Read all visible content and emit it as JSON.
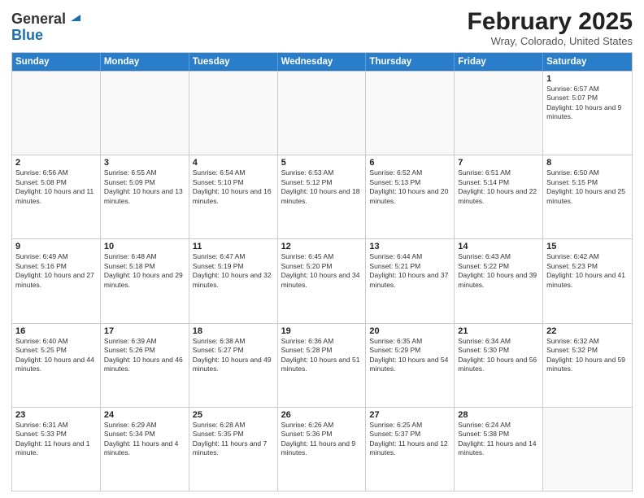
{
  "header": {
    "logo_line1": "General",
    "logo_line2": "Blue",
    "title": "February 2025",
    "subtitle": "Wray, Colorado, United States"
  },
  "calendar": {
    "days_of_week": [
      "Sunday",
      "Monday",
      "Tuesday",
      "Wednesday",
      "Thursday",
      "Friday",
      "Saturday"
    ],
    "weeks": [
      [
        {
          "day": "",
          "empty": true
        },
        {
          "day": "",
          "empty": true
        },
        {
          "day": "",
          "empty": true
        },
        {
          "day": "",
          "empty": true
        },
        {
          "day": "",
          "empty": true
        },
        {
          "day": "",
          "empty": true
        },
        {
          "day": "1",
          "sunrise": "6:57 AM",
          "sunset": "5:07 PM",
          "daylight": "10 hours and 9 minutes."
        }
      ],
      [
        {
          "day": "2",
          "sunrise": "6:56 AM",
          "sunset": "5:08 PM",
          "daylight": "10 hours and 11 minutes."
        },
        {
          "day": "3",
          "sunrise": "6:55 AM",
          "sunset": "5:09 PM",
          "daylight": "10 hours and 13 minutes."
        },
        {
          "day": "4",
          "sunrise": "6:54 AM",
          "sunset": "5:10 PM",
          "daylight": "10 hours and 16 minutes."
        },
        {
          "day": "5",
          "sunrise": "6:53 AM",
          "sunset": "5:12 PM",
          "daylight": "10 hours and 18 minutes."
        },
        {
          "day": "6",
          "sunrise": "6:52 AM",
          "sunset": "5:13 PM",
          "daylight": "10 hours and 20 minutes."
        },
        {
          "day": "7",
          "sunrise": "6:51 AM",
          "sunset": "5:14 PM",
          "daylight": "10 hours and 22 minutes."
        },
        {
          "day": "8",
          "sunrise": "6:50 AM",
          "sunset": "5:15 PM",
          "daylight": "10 hours and 25 minutes."
        }
      ],
      [
        {
          "day": "9",
          "sunrise": "6:49 AM",
          "sunset": "5:16 PM",
          "daylight": "10 hours and 27 minutes."
        },
        {
          "day": "10",
          "sunrise": "6:48 AM",
          "sunset": "5:18 PM",
          "daylight": "10 hours and 29 minutes."
        },
        {
          "day": "11",
          "sunrise": "6:47 AM",
          "sunset": "5:19 PM",
          "daylight": "10 hours and 32 minutes."
        },
        {
          "day": "12",
          "sunrise": "6:45 AM",
          "sunset": "5:20 PM",
          "daylight": "10 hours and 34 minutes."
        },
        {
          "day": "13",
          "sunrise": "6:44 AM",
          "sunset": "5:21 PM",
          "daylight": "10 hours and 37 minutes."
        },
        {
          "day": "14",
          "sunrise": "6:43 AM",
          "sunset": "5:22 PM",
          "daylight": "10 hours and 39 minutes."
        },
        {
          "day": "15",
          "sunrise": "6:42 AM",
          "sunset": "5:23 PM",
          "daylight": "10 hours and 41 minutes."
        }
      ],
      [
        {
          "day": "16",
          "sunrise": "6:40 AM",
          "sunset": "5:25 PM",
          "daylight": "10 hours and 44 minutes."
        },
        {
          "day": "17",
          "sunrise": "6:39 AM",
          "sunset": "5:26 PM",
          "daylight": "10 hours and 46 minutes."
        },
        {
          "day": "18",
          "sunrise": "6:38 AM",
          "sunset": "5:27 PM",
          "daylight": "10 hours and 49 minutes."
        },
        {
          "day": "19",
          "sunrise": "6:36 AM",
          "sunset": "5:28 PM",
          "daylight": "10 hours and 51 minutes."
        },
        {
          "day": "20",
          "sunrise": "6:35 AM",
          "sunset": "5:29 PM",
          "daylight": "10 hours and 54 minutes."
        },
        {
          "day": "21",
          "sunrise": "6:34 AM",
          "sunset": "5:30 PM",
          "daylight": "10 hours and 56 minutes."
        },
        {
          "day": "22",
          "sunrise": "6:32 AM",
          "sunset": "5:32 PM",
          "daylight": "10 hours and 59 minutes."
        }
      ],
      [
        {
          "day": "23",
          "sunrise": "6:31 AM",
          "sunset": "5:33 PM",
          "daylight": "11 hours and 1 minute."
        },
        {
          "day": "24",
          "sunrise": "6:29 AM",
          "sunset": "5:34 PM",
          "daylight": "11 hours and 4 minutes."
        },
        {
          "day": "25",
          "sunrise": "6:28 AM",
          "sunset": "5:35 PM",
          "daylight": "11 hours and 7 minutes."
        },
        {
          "day": "26",
          "sunrise": "6:26 AM",
          "sunset": "5:36 PM",
          "daylight": "11 hours and 9 minutes."
        },
        {
          "day": "27",
          "sunrise": "6:25 AM",
          "sunset": "5:37 PM",
          "daylight": "11 hours and 12 minutes."
        },
        {
          "day": "28",
          "sunrise": "6:24 AM",
          "sunset": "5:38 PM",
          "daylight": "11 hours and 14 minutes."
        },
        {
          "day": "",
          "empty": true
        }
      ]
    ]
  }
}
